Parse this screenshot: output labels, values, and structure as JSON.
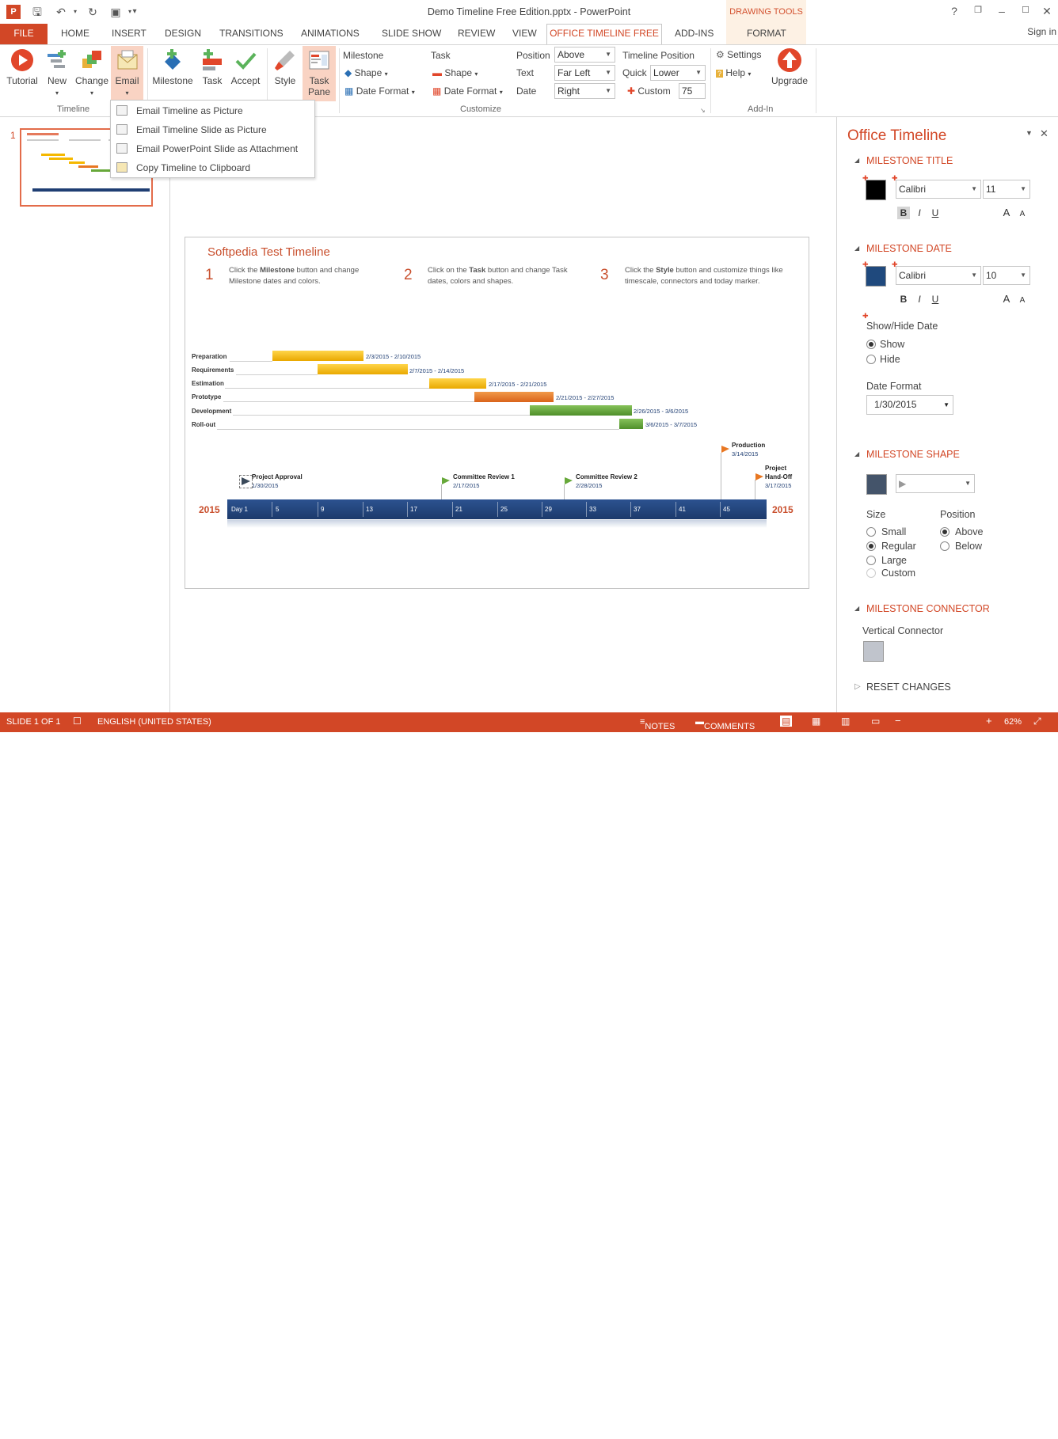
{
  "app": {
    "window_title": "Demo Timeline Free Edition.pptx - PowerPoint",
    "contextual_group": "DRAWING TOOLS",
    "help": "?",
    "sign_in": "Sign in"
  },
  "tabs": {
    "file": "FILE",
    "home": "HOME",
    "insert": "INSERT",
    "design": "DESIGN",
    "transitions": "TRANSITIONS",
    "animations": "ANIMATIONS",
    "slide_show": "SLIDE SHOW",
    "review": "REVIEW",
    "view": "VIEW",
    "office_timeline_free": "OFFICE TIMELINE FREE",
    "add_ins": "ADD-INS",
    "format": "FORMAT"
  },
  "ribbon": {
    "tutorial": "Tutorial",
    "new": "New",
    "change": "Change",
    "email": "Email",
    "group_timeline": "Timeline",
    "milestone": "Milestone",
    "task": "Task",
    "accept": "Accept",
    "style": "Style",
    "task_pane_1": "Task",
    "task_pane_2": "Pane",
    "milestone_header": "Milestone",
    "milestone_shape": "Shape",
    "milestone_date_format": "Date Format",
    "task_header": "Task",
    "task_shape": "Shape",
    "task_date_format": "Date Format",
    "position_label": "Position",
    "text_label": "Text",
    "date_label": "Date",
    "position_value": "Above",
    "text_value": "Far Left",
    "date_value": "Right",
    "timeline_position": "Timeline Position",
    "quick_label": "Quick",
    "quick_value": "Lower",
    "custom_label": "Custom",
    "custom_value": "75",
    "group_customize": "Customize",
    "settings": "Settings",
    "help": "Help",
    "upgrade": "Upgrade",
    "group_addin": "Add-In"
  },
  "email_menu": {
    "items": [
      "Email Timeline as Picture",
      "Email Timeline Slide as Picture",
      "Email PowerPoint Slide as Attachment",
      "Copy Timeline to Clipboard"
    ]
  },
  "thumbnail": {
    "number": "1"
  },
  "slide": {
    "title": "Softpedia Test Timeline",
    "steps": [
      {
        "num": "1",
        "pre": "Click the ",
        "bold": "Milestone",
        "post": " button and change Milestone dates and colors."
      },
      {
        "num": "2",
        "pre": "Click on the ",
        "bold": "Task",
        "post": " button and change Task dates, colors and shapes."
      },
      {
        "num": "3",
        "pre": "Click the ",
        "bold": "Style",
        "post": " button and customize things like timescale, connectors and today marker."
      }
    ],
    "tasks": [
      {
        "name": "Preparation",
        "dates": "2/3/2015 - 2/10/2015",
        "color": "#f5b800"
      },
      {
        "name": "Requirements",
        "dates": "2/7/2015 - 2/14/2015",
        "color": "#f5b800"
      },
      {
        "name": "Estimation",
        "dates": "2/17/2015 - 2/21/2015",
        "color": "#f5b800"
      },
      {
        "name": "Prototype",
        "dates": "2/21/2015 - 2/27/2015",
        "color": "#e87722"
      },
      {
        "name": "Development",
        "dates": "2/26/2015 - 3/6/2015",
        "color": "#67a83a"
      },
      {
        "name": "Roll-out",
        "dates": "3/6/2015 - 3/7/2015",
        "color": "#67a83a"
      }
    ],
    "milestones": [
      {
        "name": "Project Approval",
        "date": "1/30/2015"
      },
      {
        "name": "Committee Review 1",
        "date": "2/17/2015"
      },
      {
        "name": "Committee Review 2",
        "date": "2/28/2015"
      },
      {
        "name": "Production",
        "date": "3/14/2015"
      },
      {
        "name_1": "Project",
        "name_2": "Hand-Off",
        "date": "3/17/2015"
      }
    ],
    "year_left": "2015",
    "year_right": "2015",
    "scale_ticks": [
      "Day 1",
      "5",
      "9",
      "13",
      "17",
      "21",
      "25",
      "29",
      "33",
      "37",
      "41",
      "45"
    ]
  },
  "task_pane": {
    "title": "Office Timeline",
    "milestone_title": "MILESTONE TITLE",
    "title_font": "Calibri",
    "title_size": "11",
    "milestone_date": "MILESTONE DATE",
    "date_font": "Calibri",
    "date_size": "10",
    "bold": "B",
    "italic": "I",
    "underline": "U",
    "grow": "A",
    "shrink": "A",
    "show_hide_date": "Show/Hide Date",
    "show": "Show",
    "hide": "Hide",
    "date_format_label": "Date Format",
    "date_format_value": "1/30/2015",
    "milestone_shape": "MILESTONE SHAPE",
    "size_label": "Size",
    "position_label": "Position",
    "small": "Small",
    "regular": "Regular",
    "large": "Large",
    "custom": "Custom",
    "above": "Above",
    "below": "Below",
    "milestone_connector": "MILESTONE CONNECTOR",
    "vertical_connector": "Vertical Connector",
    "reset_changes": "RESET CHANGES",
    "colors": {
      "title_swatch": "#000000",
      "date_swatch": "#1f497d",
      "shape_swatch": "#44546a",
      "connector_swatch": "#c0c4cc"
    }
  },
  "status": {
    "slide": "SLIDE 1 OF 1",
    "language": "ENGLISH (UNITED STATES)",
    "notes": "NOTES",
    "comments": "COMMENTS",
    "zoom": "62%"
  }
}
